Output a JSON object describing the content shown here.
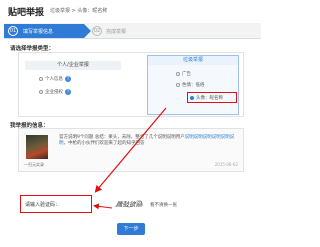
{
  "header": {
    "brand": "贴吧举报",
    "breadcrumb": "垃圾举报 > 头像：昵名称"
  },
  "steps": [
    {
      "num": "01",
      "label": "填写举报信息"
    },
    {
      "num": "02",
      "label": "完成举报"
    }
  ],
  "type_section": {
    "title": "请选择举报类型：",
    "left_column": {
      "header": "个人/企业举报",
      "options": [
        "个人信息",
        "企业侵权"
      ]
    },
    "right_column": {
      "header": "垃圾举报",
      "options": [
        "广告",
        "色情：低俗",
        "头像：昵名称"
      ],
      "selected": "头像：昵名称"
    }
  },
  "info_section": {
    "title": "我举报的信息：",
    "post": {
      "text_pre": "官方说明9个问题 总结：果头，去除，整合了几个说明说明用户",
      "link": "说明说明说明说明说明说明，",
      "text_post": "中枪的小伙伴们欢迎来了起的知乎回答",
      "caption": "—归元实录",
      "meta": "2015-06-02"
    }
  },
  "captcha": {
    "label": "请输入验证码：",
    "image_text": "厲鼓欲赑",
    "refresh": "看不清换一张"
  },
  "submit_label": "下一步",
  "colors": {
    "accent": "#2f7bd6",
    "highlight": "#dd1111"
  }
}
